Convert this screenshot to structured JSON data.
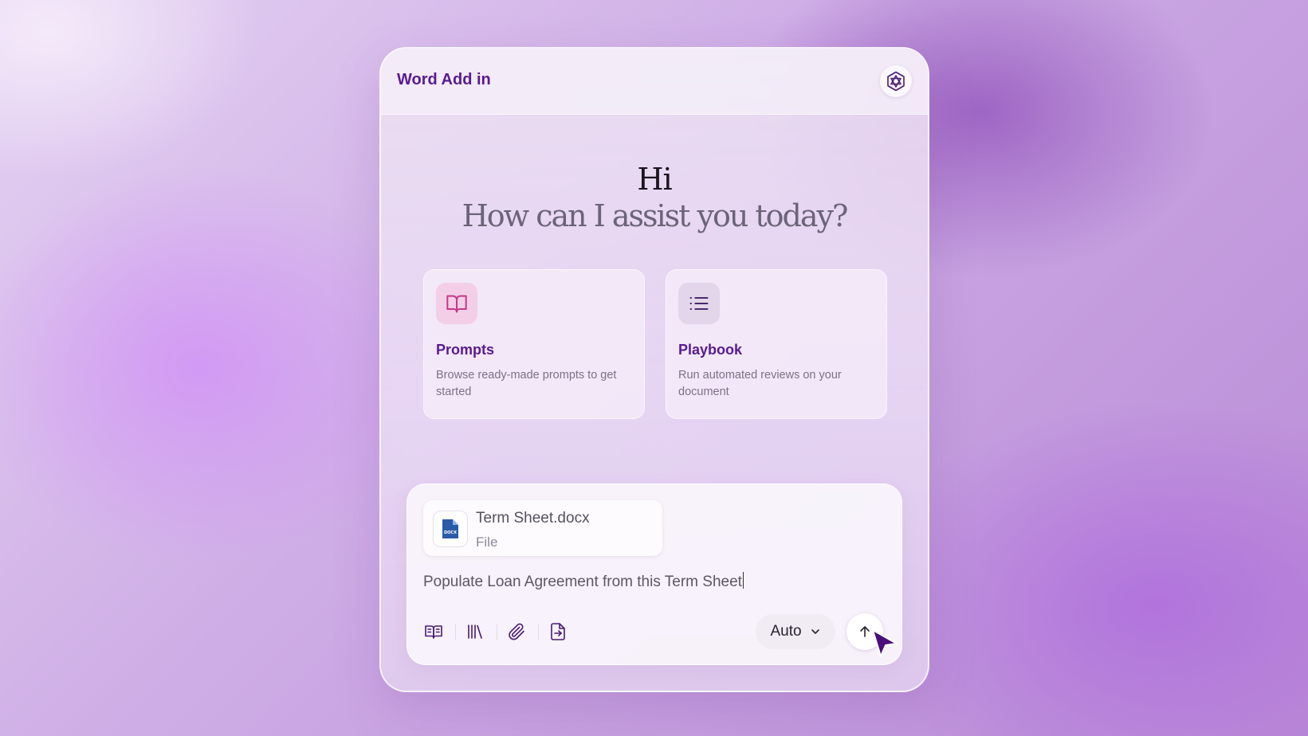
{
  "header": {
    "title": "Word Add in",
    "logo_icon": "hexagon-logo-icon"
  },
  "greeting": {
    "hi": "Hi",
    "question": "How can I assist you today?"
  },
  "cards": [
    {
      "icon": "open-book-icon",
      "title": "Prompts",
      "description": "Browse ready-made prompts to get started"
    },
    {
      "icon": "list-icon",
      "title": "Playbook",
      "description": "Run automated reviews on your document"
    }
  ],
  "composer": {
    "attachment": {
      "name": "Term Sheet.docx",
      "type": "File",
      "badge": "DOCX"
    },
    "input_value": "Populate Loan Agreement from this Term Sheet",
    "tools": [
      "prompts-book-icon",
      "library-icon",
      "paperclip-icon",
      "file-export-icon"
    ],
    "mode": {
      "selected": "Auto"
    },
    "send_icon": "arrow-up-icon"
  },
  "colors": {
    "accent": "#5a1a8e",
    "prompt_icon": "#c7378a",
    "doc_blue": "#2b5aa8"
  }
}
